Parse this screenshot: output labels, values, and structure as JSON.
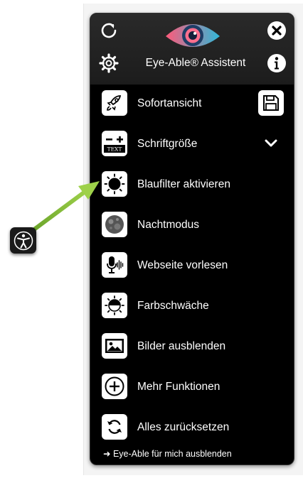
{
  "header": {
    "title": "Eye-Able® Assistent",
    "icons": [
      "reload-icon",
      "close-icon",
      "settings-icon",
      "info-icon",
      "eye-logo"
    ]
  },
  "menu": {
    "items": [
      {
        "label": "Sofortansicht",
        "icon": "rocket-icon",
        "extra": "save-icon"
      },
      {
        "label": "Schriftgröße",
        "icon": "text-size-icon",
        "extra": "chevron-down-icon",
        "icon_text": "TEXT"
      },
      {
        "label": "Blaufilter aktivieren",
        "icon": "sun-icon"
      },
      {
        "label": "Nachtmodus",
        "icon": "moon-icon"
      },
      {
        "label": "Webseite vorlesen",
        "icon": "microphone-icon"
      },
      {
        "label": "Farbschwäche",
        "icon": "color-weakness-icon"
      },
      {
        "label": "Bilder ausblenden",
        "icon": "image-icon"
      },
      {
        "label": "Mehr Funktionen",
        "icon": "plus-circle-icon"
      },
      {
        "label": "Alles zurücksetzen",
        "icon": "reset-icon"
      }
    ]
  },
  "footer": {
    "text": "➜ Eye-Able für mich ausblenden"
  },
  "floating_button": {
    "icon": "accessibility-person-icon"
  },
  "colors": {
    "panel": "#000000",
    "arrow": "#8cc63f",
    "logo_pink": "#ff5a7a",
    "logo_blue": "#2fb8d8"
  }
}
